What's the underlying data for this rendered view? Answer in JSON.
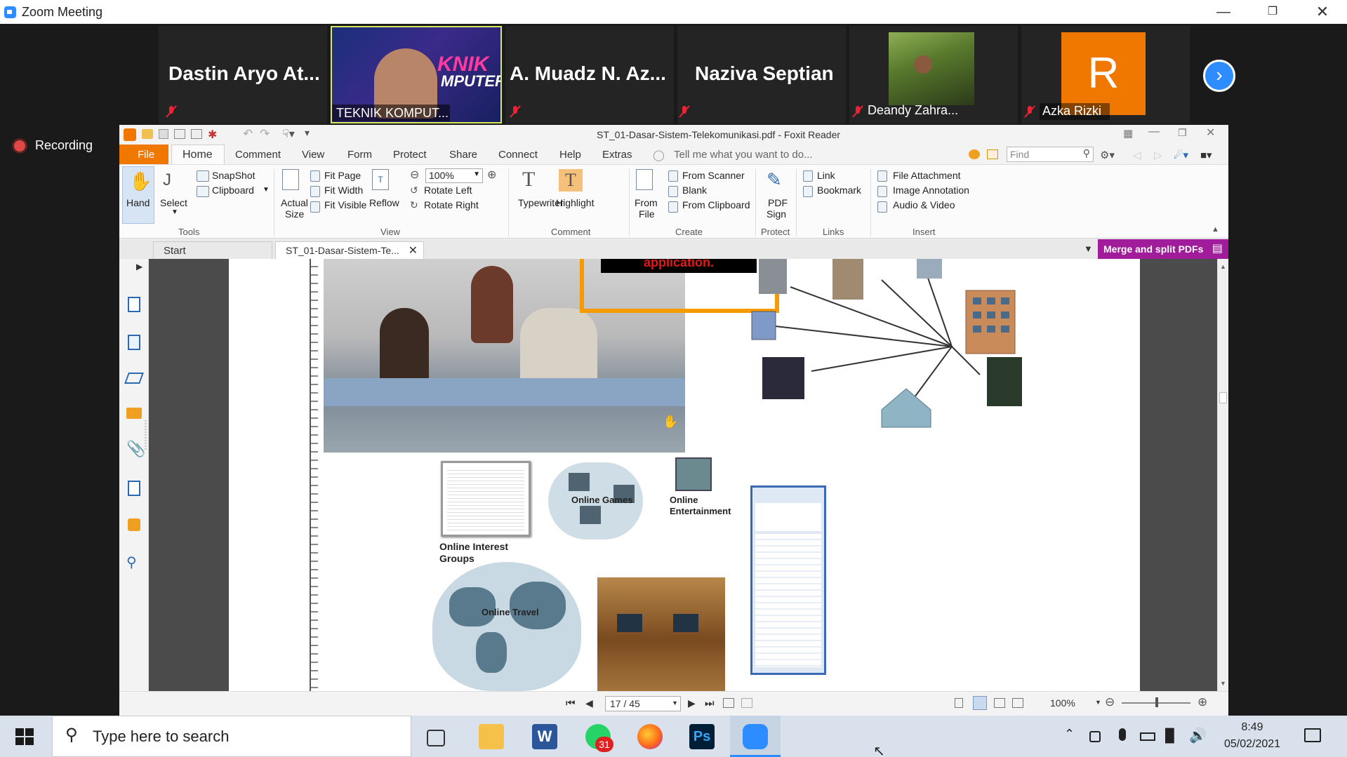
{
  "zoom": {
    "title": "Zoom Meeting",
    "recording": "Recording"
  },
  "participants": [
    {
      "name": "Dastin Aryo At...",
      "muted": true
    },
    {
      "name": "TEKNIK KOMPUT...",
      "muted": false,
      "video": true,
      "overlay": "KNIK MPUTER"
    },
    {
      "name": "A. Muadz N. Az...",
      "muted": true
    },
    {
      "name": "Naziva Septian",
      "muted": true
    },
    {
      "name": "Deandy Zahra...",
      "muted": true,
      "video": true
    },
    {
      "name": "Azka Rizki",
      "muted": true,
      "avatar_letter": "R",
      "avatar_color": "#f07800"
    }
  ],
  "foxit": {
    "window_title": "ST_01-Dasar-Sistem-Telekomunikasi.pdf - Foxit Reader",
    "menu": [
      "File",
      "Home",
      "Comment",
      "View",
      "Form",
      "Protect",
      "Share",
      "Connect",
      "Help",
      "Extras"
    ],
    "tell_me": "Tell me what you want to do...",
    "find_placeholder": "Find",
    "ribbon": {
      "hand": "Hand",
      "select": "Select",
      "snapshot": "SnapShot",
      "clipboard": "Clipboard",
      "tools_group": "Tools",
      "actual_size_1": "Actual",
      "actual_size_2": "Size",
      "fit_page": "Fit Page",
      "fit_width": "Fit Width",
      "fit_visible": "Fit Visible",
      "reflow": "Reflow",
      "zoom_value": "100%",
      "rotate_left": "Rotate Left",
      "rotate_right": "Rotate Right",
      "view_group": "View",
      "typewriter": "Typewriter",
      "highlight": "Highlight",
      "comment_group": "Comment",
      "from_file_1": "From",
      "from_file_2": "File",
      "from_scanner": "From Scanner",
      "blank": "Blank",
      "from_clipboard": "From Clipboard",
      "create_group": "Create",
      "pdf_sign_1": "PDF",
      "pdf_sign_2": "Sign",
      "protect_group": "Protect",
      "link": "Link",
      "bookmark": "Bookmark",
      "links_group": "Links",
      "file_attachment": "File Attachment",
      "image_annotation": "Image Annotation",
      "audio_video": "Audio & Video",
      "insert_group": "Insert"
    },
    "tabs": [
      "Start",
      "ST_01-Dasar-Sistem-Te..."
    ],
    "merge_button": "Merge and split PDFs",
    "overlay_notice": "away from the shared application.",
    "page_labels": {
      "online_games": "Online Games",
      "online_entertainment_1": "Online",
      "online_entertainment_2": "Entertainment",
      "online_interest_1": "Online Interest",
      "online_interest_2": "Groups",
      "online_travel": "Online Travel"
    },
    "status": {
      "page": "17 / 45",
      "zoom": "100%"
    }
  },
  "taskbar": {
    "search_placeholder": "Type here to search",
    "time": "8:49",
    "date": "05/02/2021",
    "whatsapp_badge": "31"
  },
  "colors": {
    "zoom_blue": "#2d8cff",
    "foxit_orange": "#f07800",
    "merge_purple": "#a01c9a"
  }
}
